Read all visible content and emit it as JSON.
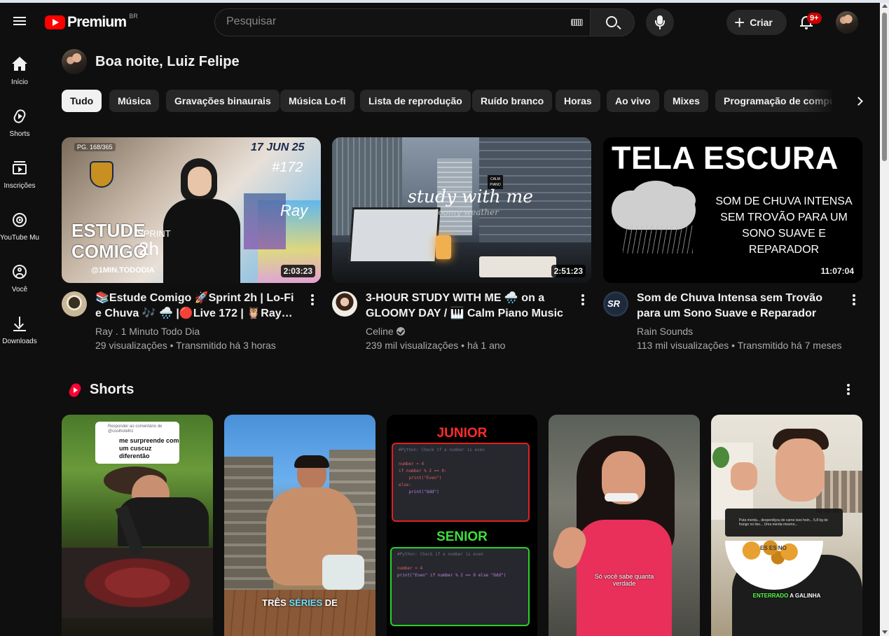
{
  "header": {
    "logo_text": "Premium",
    "country_code": "BR",
    "search_placeholder": "Pesquisar",
    "create_label": "Criar",
    "notification_count": "9+"
  },
  "sidebar": {
    "items": [
      {
        "label": "Início",
        "icon": "home-icon"
      },
      {
        "label": "Shorts",
        "icon": "shorts-icon"
      },
      {
        "label": "Inscrições",
        "icon": "subscriptions-icon"
      },
      {
        "label": "YouTube Mu…",
        "icon": "youtube-music-icon"
      },
      {
        "label": "Você",
        "icon": "you-icon"
      },
      {
        "label": "Downloads",
        "icon": "download-icon"
      }
    ]
  },
  "greeting": "Boa noite, Luiz Felipe",
  "chips": [
    {
      "label": "Tudo",
      "active": true
    },
    {
      "label": "Música"
    },
    {
      "label": "Gravações binaurais"
    },
    {
      "label": "Música Lo-fi"
    },
    {
      "label": "Lista de reprodução"
    },
    {
      "label": "Ruído branco"
    },
    {
      "label": "Horas"
    },
    {
      "label": "Ao vivo"
    },
    {
      "label": "Mixes"
    },
    {
      "label": "Programação de computadores"
    }
  ],
  "videos": [
    {
      "title": "📚Estude Comigo 🚀Sprint 2h | Lo-Fi e Chuva 🎶 🌧️ |🔴Live 172 | 🦉Ray…",
      "channel": "Ray . 1 Minuto Todo Dia",
      "meta": "29 visualizações • Transmitido há 3 horas",
      "duration": "2:03:23",
      "thumb_text": {
        "date": "17 JUN 25",
        "number": "#172",
        "ray": "Ray",
        "estude": "ESTUDE",
        "comigo": "COMIGO",
        "sprint": "SPRINT",
        "hours": "2h",
        "handle": "@1MIN.TODODIA",
        "tag": "PG. 168/365"
      }
    },
    {
      "title": "3-HOUR STUDY WITH ME 🌧️ on a GLOOMY DAY / 🎹 Calm Piano Music /…",
      "channel": "Celine",
      "verified": true,
      "meta": "239 mil visualizações • há 1 ano",
      "duration": "2:51:23",
      "thumb_text": {
        "study": "study with me",
        "gloomy": "gloomy weather",
        "calm": "CALM PIANO"
      }
    },
    {
      "title": "Som de Chuva Intensa sem Trovão para um Sono Suave e Reparador",
      "channel": "Rain Sounds",
      "meta": "113 mil visualizações • Transmitido há 7 meses",
      "duration": "11:07:04",
      "thumb_text": {
        "big": "TELA ESCURA",
        "sub": "SOM DE CHUVA INTENSA SEM TROVÃO PARA UM SONO SUAVE E REPARADOR"
      }
    }
  ],
  "shorts": {
    "heading": "Shorts",
    "items": [
      {
        "comment_header": "Responder ao comentário de @coolhotelhz",
        "comment": "me surpreende com um cuscuz diferentão"
      },
      {
        "caption_a": "TRÊS ",
        "caption_b": "SÉRIES",
        "caption_c": " DE"
      },
      {
        "top_label": "JUNIOR",
        "bottom_label": "SENIOR",
        "junior_code": [
          "#Python: Check if a number is even",
          "",
          "number = 4",
          "if number % 2 == 0:",
          "    print(\"Even\")",
          "else:",
          "    print(\"Odd\")"
        ],
        "senior_code": [
          "#Python: Check if a number is even",
          "",
          "number = 4",
          "print(\"Even\" if number % 2 == 0 else \"Odd\")"
        ]
      },
      {
        "caption": "Só você sabe quanta verdade"
      },
      {
        "comment": "Puta merda... desperdiçou de carne isso hein... 5,8 kg de frango no lixo... Uma merda mesmo...",
        "caption_a": "ENTERRADO",
        "caption_b": " A GALINHA",
        "sign": "ES ES NO"
      }
    ]
  }
}
